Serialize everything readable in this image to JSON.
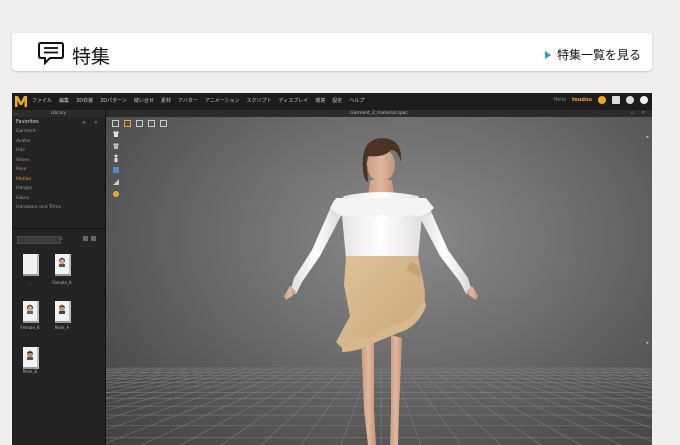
{
  "feature": {
    "title": "特集",
    "link_label": "特集一覧を見る",
    "icon": "speech-bubble-icon"
  },
  "app": {
    "menu": [
      "ファイル",
      "編集",
      "3D衣装",
      "2Dパターン",
      "縫い合せ",
      "素材",
      "アバター",
      "アニメーション",
      "スクリプト",
      "ディスプレイ",
      "環境",
      "設定",
      "ヘルプ"
    ],
    "user_prefix": "Hello",
    "user_name": "toudou",
    "library": {
      "header": "Library",
      "favorites_label": "Favorites",
      "favorites": [
        "Garment",
        "Avatar",
        "Hair",
        "Shoes",
        "Pose",
        "Motion",
        "Hanger",
        "Fabric",
        "Hardware and Trims"
      ],
      "active_favorite": "Motion",
      "items": [
        "..",
        "Female_A",
        "Female_B",
        "Male_A",
        "Male_B"
      ]
    },
    "viewport": {
      "title": "Garment_2_material.zpac"
    },
    "accent_color": "#f0a81e"
  }
}
